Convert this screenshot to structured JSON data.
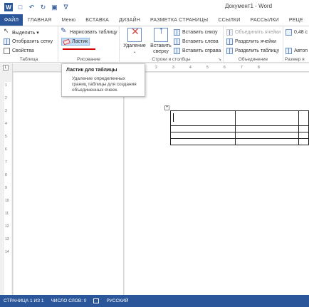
{
  "title_bar": {
    "document_title": "Документ1 - Word",
    "app_icon": "word-icon",
    "quick_access": [
      "save-icon",
      "undo-icon",
      "redo-icon",
      "new-document-icon",
      "customize-icon"
    ]
  },
  "tabs": [
    {
      "label": "ФАЙЛ"
    },
    {
      "label": "ГЛАВНАЯ"
    },
    {
      "label": "Меню"
    },
    {
      "label": "ВСТАВКА"
    },
    {
      "label": "ДИЗАЙН"
    },
    {
      "label": "РАЗМЕТКА СТРАНИЦЫ"
    },
    {
      "label": "ССЫЛКИ"
    },
    {
      "label": "РАССЫЛКИ"
    },
    {
      "label": "РЕЦЕ"
    }
  ],
  "ribbon": {
    "table_group": {
      "label": "Таблица",
      "select": "Выделить ▾",
      "gridlines": "Отобразить сетку",
      "properties": "Свойства"
    },
    "draw_group": {
      "label": "Рисование",
      "draw_table": "Нарисовать таблицу",
      "eraser": "Ластик"
    },
    "rows_group": {
      "label": "Строки и столбцы",
      "delete": "Удаление",
      "insert_above_1": "Вставить",
      "insert_above_2": "сверху",
      "insert_below": "Вставить снизу",
      "insert_left": "Вставить слева",
      "insert_right": "Вставить справа"
    },
    "merge_group": {
      "label": "Объединение",
      "merge_cells": "Объединить ячейки",
      "split_cells": "Разделить ячейки",
      "split_table": "Разделить таблицу"
    },
    "size_group": {
      "label": "Размер я",
      "height_value": "0,48 с",
      "autofit": "Автоп"
    }
  },
  "tooltip": {
    "title": "Ластик для таблицы",
    "body": "Удаление определенных границ таблицы для создания объединенных ячеек."
  },
  "ruler": {
    "marks": [
      "1",
      "2",
      "1",
      "2",
      "3",
      "4",
      "5",
      "6",
      "7",
      "8"
    ],
    "vmarks": [
      "1",
      "2",
      "3",
      "4",
      "5",
      "6",
      "7",
      "8",
      "9",
      "10",
      "11",
      "12",
      "13",
      "14"
    ]
  },
  "status_bar": {
    "page": "СТРАНИЦА 1 ИЗ 1",
    "words": "ЧИСЛО СЛОВ: 0",
    "language": "РУССКИЙ"
  },
  "colors": {
    "accent": "#2b579a",
    "underline": "#d00000"
  }
}
